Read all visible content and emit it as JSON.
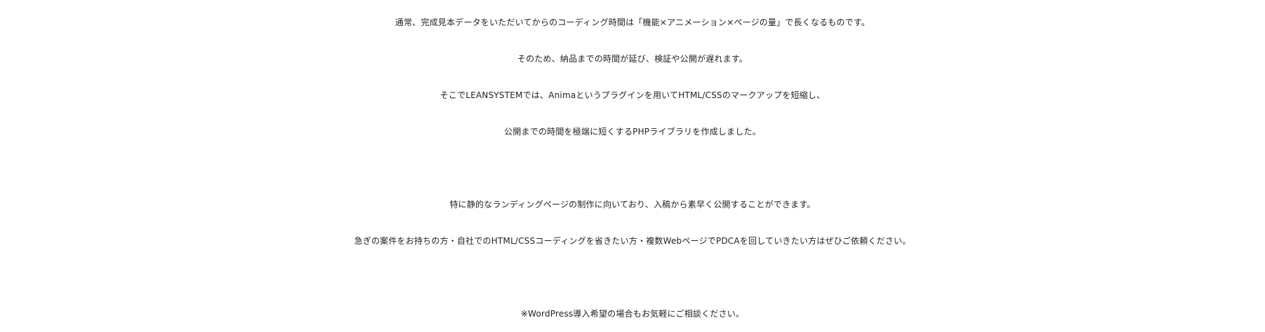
{
  "paragraphs": [
    {
      "lines": [
        "通常、完成見本データをいただいてからのコーディング時間は「機能×アニメーション×ページの量」で長くなるものです。",
        "そのため、納品までの時間が延び、検証や公開が遅れます。",
        "そこでLEANSYSTEMでは、Animaというプラグインを用いてHTML/CSSのマークアップを短縮し、",
        "公開までの時間を極端に短くするPHPライブラリを作成しました。"
      ]
    },
    {
      "lines": [
        "特に静的なランディングページの制作に向いており、入稿から素早く公開することができます。",
        "急ぎの案件をお持ちの方・自社でのHTML/CSSコーディングを省きたい方・複数WebページでPDCAを回していきたい方はぜひご依頼ください。"
      ]
    },
    {
      "lines": [
        "※WordPress導入希望の場合もお気軽にご相談ください。"
      ]
    }
  ]
}
